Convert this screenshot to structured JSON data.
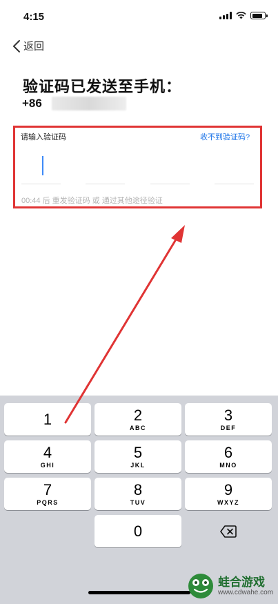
{
  "status_bar": {
    "time": "4:15"
  },
  "nav": {
    "back_label": "返回"
  },
  "title": "验证码已发送至手机：",
  "phone": {
    "prefix": "+86"
  },
  "code_entry": {
    "prompt": "请输入验证码",
    "help_link": "收不到验证码?",
    "resend_hint": "00:44 后 重发验证码 或 通过其他途径验证"
  },
  "keyboard": {
    "keys": [
      {
        "digit": "1",
        "letters": ""
      },
      {
        "digit": "2",
        "letters": "ABC"
      },
      {
        "digit": "3",
        "letters": "DEF"
      },
      {
        "digit": "4",
        "letters": "GHI"
      },
      {
        "digit": "5",
        "letters": "JKL"
      },
      {
        "digit": "6",
        "letters": "MNO"
      },
      {
        "digit": "7",
        "letters": "PQRS"
      },
      {
        "digit": "8",
        "letters": "TUV"
      },
      {
        "digit": "9",
        "letters": "WXYZ"
      },
      {
        "digit": "0",
        "letters": ""
      }
    ],
    "delete_icon": "backspace-icon"
  },
  "watermark": {
    "name": "蛙合游戏",
    "url": "www.cdwahe.com"
  },
  "colors": {
    "highlight": "#e03434",
    "link": "#1a73e8",
    "cursor": "#3d8af7",
    "keyboard_bg": "#d1d3d9"
  }
}
